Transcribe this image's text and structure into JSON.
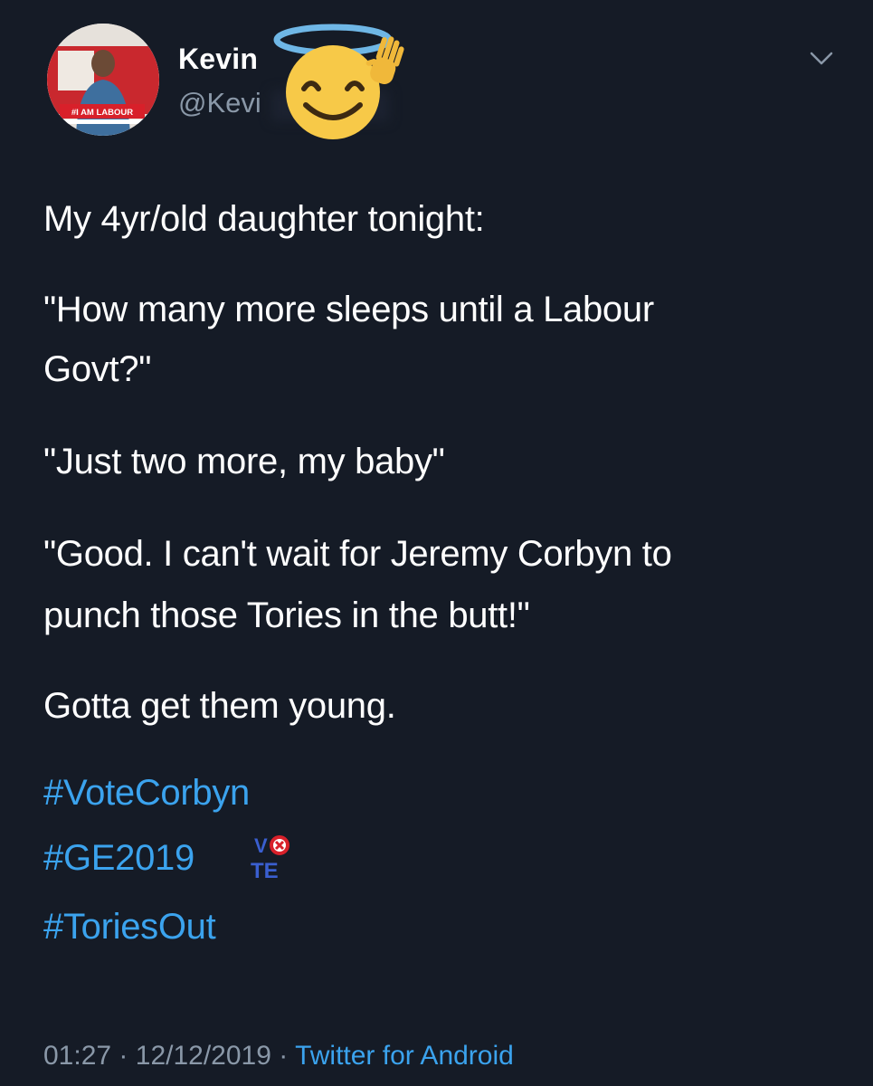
{
  "author": {
    "display_name": "Kevin",
    "handle": "@Kevi",
    "avatar_banner_text": "#I AM LABOUR"
  },
  "tweet": {
    "lines": [
      "My 4yr/old daughter tonight:",
      "\"How many more sleeps until a Labour",
      "Govt?\"",
      "\"Just two more, my baby\"",
      "\"Good. I can't wait for Jeremy Corbyn to",
      "punch those Tories in the butt!\"",
      "Gotta get them young."
    ],
    "hashtags": [
      "#VoteCorbyn",
      "#GE2019",
      "#ToriesOut"
    ],
    "vote_emoji_text": [
      "V",
      "TE"
    ]
  },
  "footer": {
    "time": "01:27",
    "separator": "·",
    "date": "12/12/2019",
    "source": "Twitter for Android"
  },
  "colors": {
    "background": "#151b26",
    "text": "#ffffff",
    "muted": "#8a98a8",
    "link": "#3ba3ee",
    "emoji_face": "#f7c948",
    "halo": "#6fb7e6",
    "labour_red": "#d8202a"
  },
  "icons": {
    "menu": "chevron-down-icon",
    "sticker": "smiling-face-with-halo-icon"
  }
}
